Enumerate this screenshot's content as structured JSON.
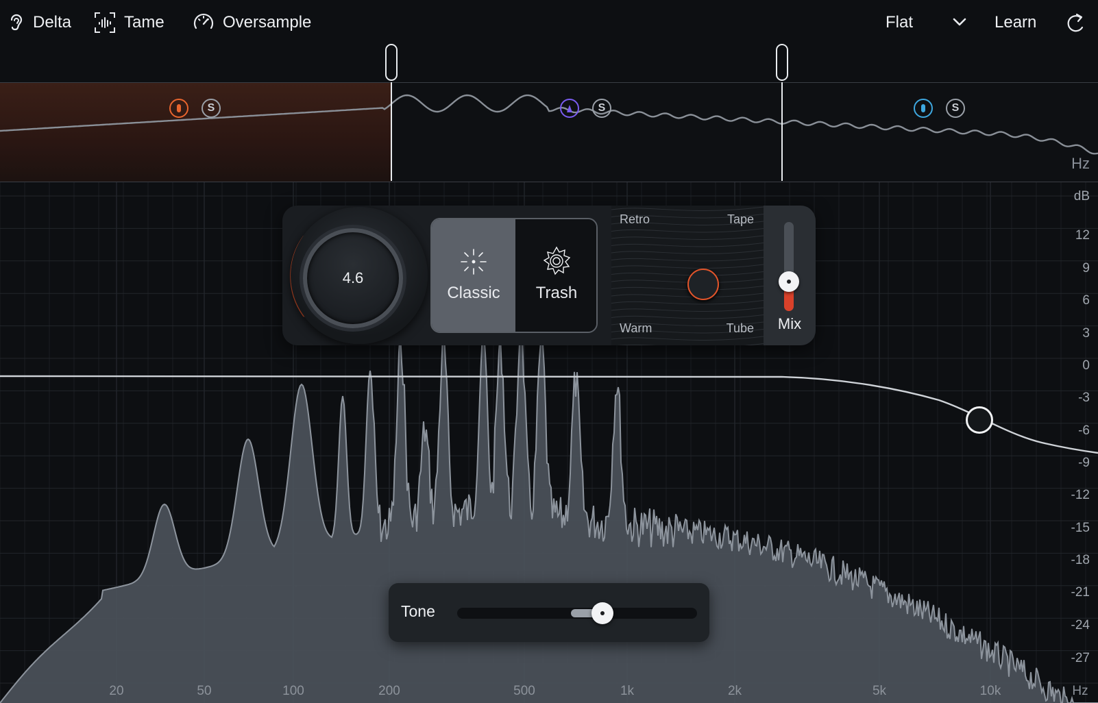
{
  "toolbar": {
    "delta_label": "Delta",
    "tame_label": "Tame",
    "oversample_label": "Oversample",
    "preset_value": "Flat",
    "learn_label": "Learn"
  },
  "band_strip": {
    "hz_unit": "Hz",
    "bands": [
      {
        "color": "#e8652e",
        "solo_label": "S"
      },
      {
        "color": "#7a5cf0",
        "solo_label": "S"
      },
      {
        "color": "#3ea8e0",
        "solo_label": "S"
      }
    ]
  },
  "panel": {
    "drive_value": "4.6",
    "mode_classic": "Classic",
    "mode_trash": "Trash",
    "selected_mode": "Classic",
    "xy_top_left": "Retro",
    "xy_top_right": "Tape",
    "xy_bottom_left": "Warm",
    "xy_bottom_right": "Tube",
    "mix_label": "Mix",
    "mix_value": 0.3
  },
  "tone": {
    "label": "Tone",
    "value": 0.62
  },
  "axes": {
    "db_unit": "dB",
    "db_ticks": [
      "12",
      "9",
      "6",
      "3",
      "0",
      "-3",
      "-6",
      "-9",
      "-12",
      "-15",
      "-18",
      "-21",
      "-24",
      "-27"
    ],
    "hz_unit": "Hz",
    "hz_ticks": [
      "20",
      "50",
      "100",
      "200",
      "500",
      "1k",
      "2k",
      "5k",
      "10k"
    ]
  },
  "colors": {
    "accent": "#e2552b",
    "low_band": "#e8652e",
    "mid_band": "#7a5cf0",
    "high_band": "#3ea8e0"
  }
}
